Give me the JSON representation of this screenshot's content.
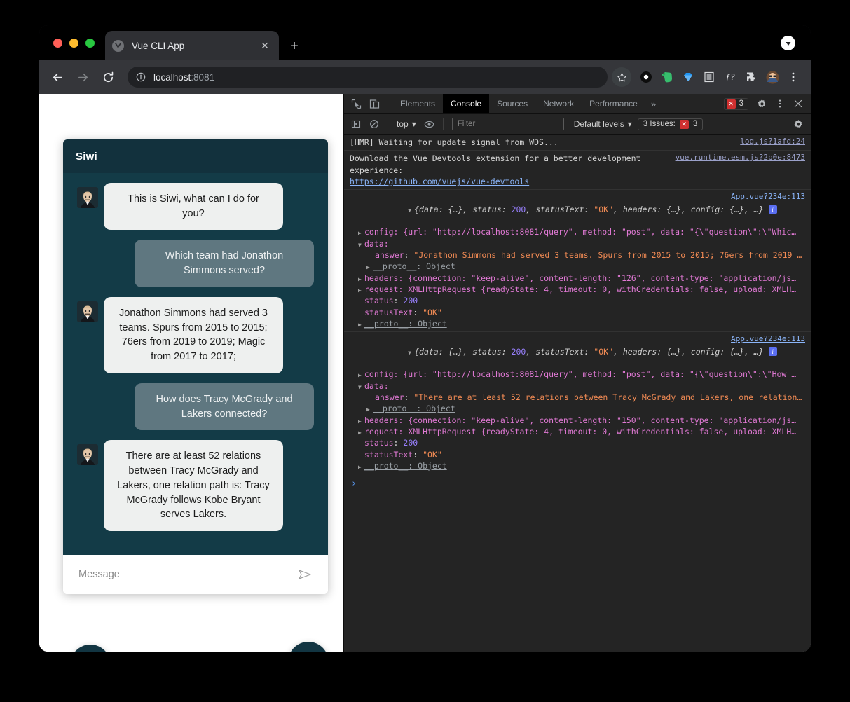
{
  "browser": {
    "tab_title": "Vue CLI App",
    "tab_close_label": "✕",
    "new_tab_label": "+",
    "url_host": "localhost",
    "url_rest": ":8081",
    "back_icon": "back-arrow-icon",
    "forward_icon": "forward-arrow-icon",
    "reload_icon": "reload-icon",
    "info_icon": "site-info-icon",
    "star_icon": "bookmark-star-icon",
    "extensions": [
      "circle-extension-icon",
      "evernote-icon",
      "diamond-extension-icon",
      "reader-list-icon",
      "function-extension-icon",
      "puzzle-extensions-icon",
      "profile-avatar-icon"
    ],
    "menu_icon": "chrome-menu-icon",
    "window_badge_icon": "download-indicator-icon"
  },
  "chat": {
    "title": "Siwi",
    "messages": [
      {
        "from": "bot",
        "text": "This is Siwi, what can I do for you?"
      },
      {
        "from": "user",
        "text": "Which team had Jonathon Simmons served?"
      },
      {
        "from": "bot",
        "text": "Jonathon Simmons had served 3 teams. Spurs from 2015 to 2015; 76ers from 2019 to 2019; Magic from 2017 to 2017;"
      },
      {
        "from": "user",
        "text": "How does Tracy McGrady and Lakers connected?"
      },
      {
        "from": "bot",
        "text": "There are at least 52 relations between Tracy McGrady and Lakers, one relation path is: Tracy McGrady follows Kobe Bryant serves Lakers."
      }
    ],
    "input_placeholder": "Message",
    "input_value": "",
    "send_icon": "send-paper-plane-icon",
    "mic_fab_icon": "microphone-icon",
    "close_fab_icon": "close-x-icon",
    "colors": {
      "header": "#12313d",
      "body": "#133b47",
      "user_bubble": "#5f7780",
      "bot_bubble": "#eef0ef",
      "fab": "#123542"
    }
  },
  "devtools": {
    "inspect_icon": "inspect-element-icon",
    "device_icon": "device-toolbar-icon",
    "tabs": [
      {
        "label": "Elements",
        "active": false
      },
      {
        "label": "Console",
        "active": true
      },
      {
        "label": "Sources",
        "active": false
      },
      {
        "label": "Network",
        "active": false
      },
      {
        "label": "Performance",
        "active": false
      }
    ],
    "more_tabs_label": "»",
    "error_badge_count": "3",
    "settings_icon": "gear-icon",
    "kebab_icon": "more-options-icon",
    "close_icon": "close-devtools-icon",
    "toolbar": {
      "sidebar_icon": "console-sidebar-icon",
      "clear_icon": "clear-console-icon",
      "context_label": "top",
      "context_caret": "▾",
      "eye_icon": "live-expression-icon",
      "filter_placeholder": "Filter",
      "filter_value": "",
      "levels_label": "Default levels",
      "levels_caret": "▾",
      "issues_label": "3 Issues:",
      "issues_count": "3",
      "settings_icon": "console-settings-gear-icon"
    },
    "console": {
      "entry1": {
        "text": "[HMR] Waiting for update signal from WDS...",
        "source": "log.js?1afd:24"
      },
      "entry2": {
        "line1": "Download the Vue Devtools extension for a better development",
        "line2": "experience:",
        "link": "https://github.com/vuejs/vue-devtools",
        "source": "vue.runtime.esm.js?2b0e:8473"
      },
      "entry3": {
        "source": "App.vue?234e:113",
        "summary_prefix": "{data: {…}, status: ",
        "status": "200",
        "summary_mid": ", statusText: ",
        "status_text": "\"OK\"",
        "summary_suffix": ", headers: {…}, config: {…}, …}",
        "config_line": "config: {url: \"http://localhost:8081/query\", method: \"post\", data: \"{\\\"question\\\":\\\"Whic…",
        "data_label": "data:",
        "answer_key": "answer",
        "answer_value": "\"Jonathon Simmons had served 3 teams. Spurs from 2015 to 2015; 76ers from 2019 …",
        "proto_label": "__proto__: Object",
        "headers_line": "headers: {connection: \"keep-alive\", content-length: \"126\", content-type: \"application/js…",
        "request_line": "request: XMLHttpRequest {readyState: 4, timeout: 0, withCredentials: false, upload: XMLH…",
        "status_line_key": "status",
        "status_line_val": "200",
        "status_text_key": "statusText",
        "status_text_val": "\"OK\"",
        "proto_line": "__proto__: Object"
      },
      "entry4": {
        "source": "App.vue?234e:113",
        "summary_prefix": "{data: {…}, status: ",
        "status": "200",
        "summary_mid": ", statusText: ",
        "status_text": "\"OK\"",
        "summary_suffix": ", headers: {…}, config: {…}, …}",
        "config_line": "config: {url: \"http://localhost:8081/query\", method: \"post\", data: \"{\\\"question\\\":\\\"How …",
        "data_label": "data:",
        "answer_key": "answer",
        "answer_value": "\"There are at least 52 relations between Tracy McGrady and Lakers, one relation…",
        "proto_label": "__proto__: Object",
        "headers_line": "headers: {connection: \"keep-alive\", content-length: \"150\", content-type: \"application/js…",
        "request_line": "request: XMLHttpRequest {readyState: 4, timeout: 0, withCredentials: false, upload: XMLH…",
        "status_line_key": "status",
        "status_line_val": "200",
        "status_text_key": "statusText",
        "status_text_val": "\"OK\"",
        "proto_line": "__proto__: Object"
      },
      "prompt_caret": "›"
    }
  }
}
